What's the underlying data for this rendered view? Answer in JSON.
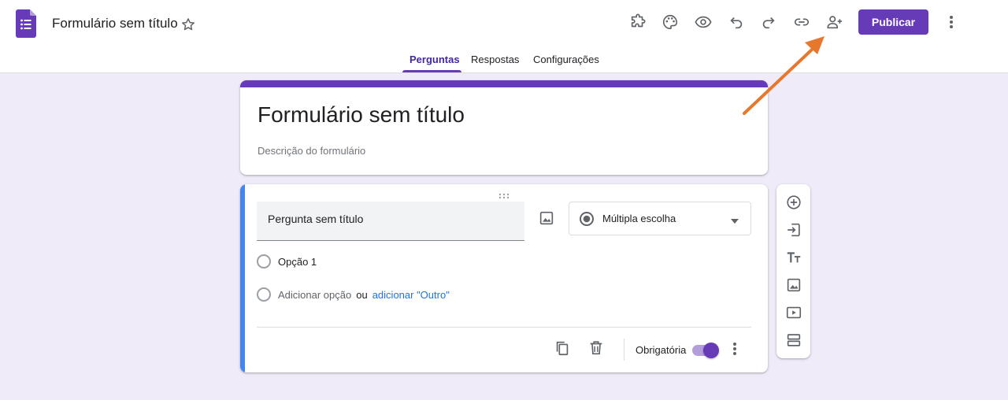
{
  "header": {
    "doc_title": "Formulário sem título",
    "publish_label": "Publicar",
    "icons": [
      "add-ons-icon",
      "palette-icon",
      "preview-icon",
      "undo-icon",
      "redo-icon",
      "link-icon",
      "add-collaborator-icon",
      "more-vert-icon"
    ]
  },
  "tabs": [
    {
      "label": "Perguntas",
      "active": true
    },
    {
      "label": "Respostas",
      "active": false
    },
    {
      "label": "Configurações",
      "active": false
    }
  ],
  "form": {
    "title": "Formulário sem título",
    "description_placeholder": "Descrição do formulário"
  },
  "question": {
    "title": "Pergunta sem título",
    "type": "Múltipla escolha",
    "options": [
      "Opção 1"
    ],
    "add_option": "Adicionar opção",
    "or_text": "ou",
    "add_other": "adicionar \"Outro\"",
    "required_label": "Obrigatória",
    "required": true
  },
  "sidebar": {
    "tools": [
      "add-question-icon",
      "import-questions-icon",
      "add-title-icon",
      "add-image-icon",
      "add-video-icon",
      "add-section-icon"
    ]
  },
  "colors": {
    "accent": "#673ab7",
    "background": "#f0ebf8",
    "focus_bar": "#4285f4",
    "annotation_arrow": "#e8772e"
  }
}
